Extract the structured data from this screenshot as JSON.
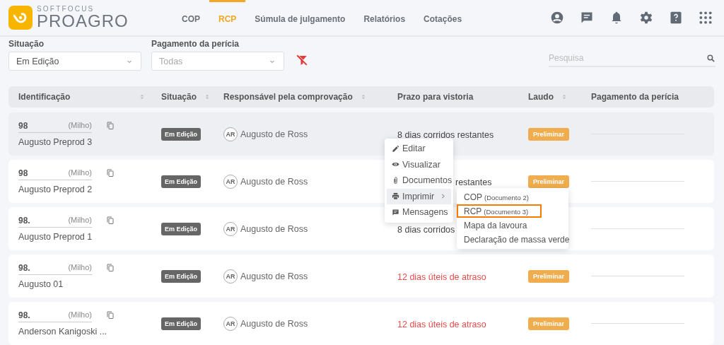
{
  "brand": {
    "top": "SOFTFOCUS",
    "name": "PROAGRO"
  },
  "nav": [
    {
      "label": "COP",
      "selected": false
    },
    {
      "label": "RCP",
      "selected": true
    },
    {
      "label": "Súmula de julgamento",
      "selected": false
    },
    {
      "label": "Relatórios",
      "selected": false
    },
    {
      "label": "Cotações",
      "selected": false
    }
  ],
  "filters": [
    {
      "label": "Situação",
      "value": "Em Edição"
    },
    {
      "label": "Pagamento da perícia",
      "placeholder": "Todas"
    }
  ],
  "search": {
    "placeholder": "Pesquisa"
  },
  "table": {
    "columns": [
      {
        "label": "Identificação",
        "sortable": true
      },
      {
        "label": "Situação",
        "sortable": true
      },
      {
        "label": "Responsável pela comprovação",
        "sortable": true
      },
      {
        "label": "Prazo para vistoria",
        "sortable": false
      },
      {
        "label": "Laudo",
        "sortable": true
      },
      {
        "label": "Pagamento da perícia",
        "sortable": false
      }
    ],
    "rows": [
      {
        "id": "98",
        "crop": "(Milho)",
        "name": "Augusto Preprod 3",
        "selected": true,
        "situacao": "Em Edição",
        "avatar": "AR",
        "responsavel": "Augusto de Ross",
        "prazo": "8 dias corridos restantes",
        "prazo_covered": false,
        "overdue": false,
        "laudo": "Preliminar"
      },
      {
        "id": "98",
        "crop": "(Milho)",
        "name": "Augusto Preprod 2",
        "selected": false,
        "situacao": "Em Edição",
        "avatar": "AR",
        "responsavel": "Augusto de Ross",
        "prazo": "restantes",
        "prazo_covered": true,
        "overdue": false,
        "laudo": "Preliminar"
      },
      {
        "id": "98.",
        "crop": "(Milho)",
        "name": "Augusto Preprod 1",
        "selected": false,
        "situacao": "Em Edição",
        "avatar": "AR",
        "responsavel": "Augusto de Ross",
        "prazo": "8 dias corridos",
        "prazo_covered": false,
        "overdue": false
      },
      {
        "id": "98.",
        "crop": "(Milho)",
        "name": "Augusto 01",
        "selected": false,
        "situacao": "Em Edição",
        "avatar": "AR",
        "responsavel": "Augusto de Ross",
        "prazo": "12 dias úteis de atraso",
        "prazo_covered": false,
        "overdue": true,
        "laudo": "Preliminar"
      },
      {
        "id": "98.",
        "crop": "(Milho)",
        "name": "Anderson Kanigoski ...",
        "selected": false,
        "situacao": "Em Edição",
        "avatar": "AR",
        "responsavel": "Augusto de Ross",
        "prazo": "12 dias úteis de atraso",
        "prazo_covered": false,
        "overdue": true,
        "laudo": "Preliminar"
      }
    ]
  },
  "context_menu": {
    "items": [
      {
        "label": "Editar",
        "selected": false,
        "has_submenu": false
      },
      {
        "label": "Visualizar",
        "selected": false,
        "has_submenu": false
      },
      {
        "label": "Documentos",
        "selected": false,
        "has_submenu": false
      },
      {
        "label": "Imprimir",
        "selected": true,
        "has_submenu": true
      },
      {
        "label": "Mensagens",
        "selected": false,
        "has_submenu": false
      }
    ],
    "submenu": [
      {
        "label": "COP",
        "note": "(Documento 2)",
        "selected": false
      },
      {
        "label": "RCP",
        "note": "(Documento 3)",
        "selected": true
      },
      {
        "label": "Mapa da lavoura",
        "selected": false
      },
      {
        "label": "Declaração de massa verde",
        "selected": false
      }
    ]
  }
}
